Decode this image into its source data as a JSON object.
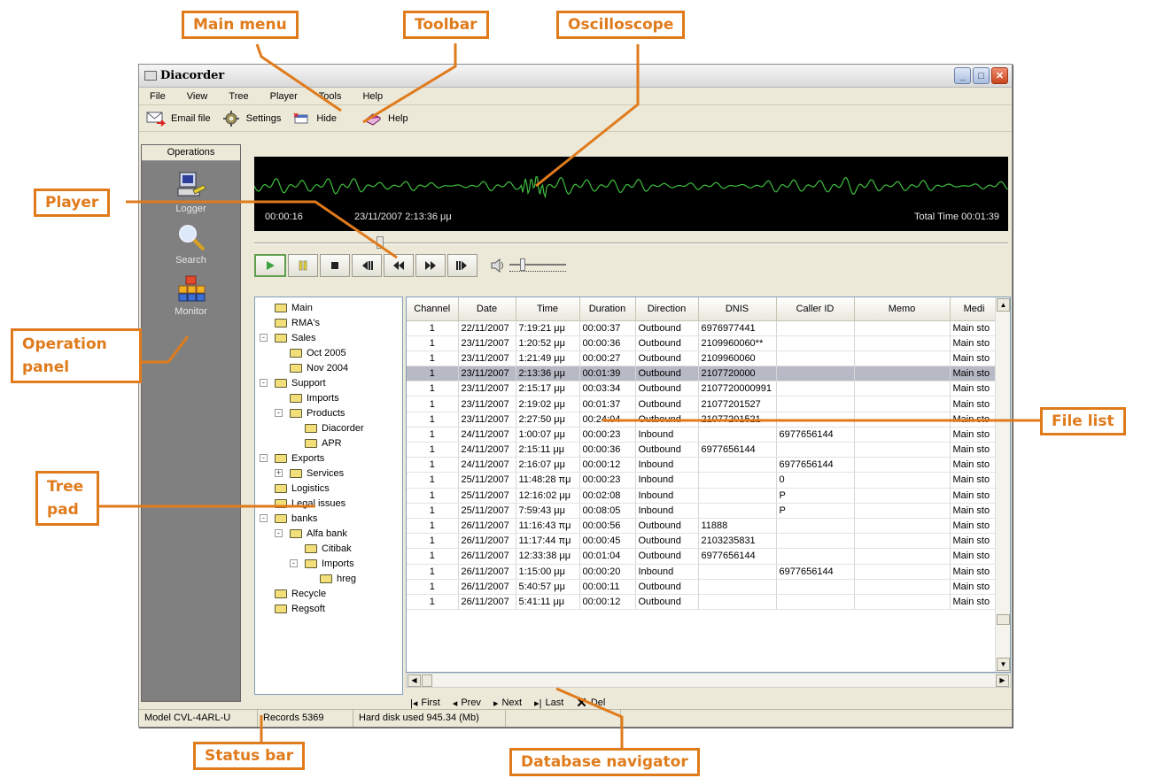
{
  "window": {
    "title": "Diacorder"
  },
  "menu": [
    "File",
    "View",
    "Tree",
    "Player",
    "Tools",
    "Help"
  ],
  "toolbar": [
    {
      "label": "Email file",
      "icon": "email-icon"
    },
    {
      "label": "Settings",
      "icon": "settings-icon"
    },
    {
      "label": "Hide",
      "icon": "hide-icon"
    },
    {
      "label": "Help",
      "icon": "help-book-icon"
    }
  ],
  "operations": {
    "header": "Operations",
    "items": [
      {
        "label": "Logger",
        "icon": "logger-icon"
      },
      {
        "label": "Search",
        "icon": "search-icon"
      },
      {
        "label": "Monitor",
        "icon": "monitor-icon"
      }
    ]
  },
  "oscilloscope": {
    "position": "00:00:16",
    "timestamp": "23/11/2007 2:13:36 μμ",
    "total": "Total Time 00:01:39",
    "seek_fraction": 0.162
  },
  "player": {
    "buttons": [
      "play-icon",
      "pause-icon",
      "stop-icon",
      "step-back-icon",
      "rewind-icon",
      "fast-forward-icon",
      "step-forward-icon"
    ],
    "volume_fraction": 0.2
  },
  "tree": [
    {
      "label": "Main",
      "depth": 0,
      "exp": "",
      "open": true
    },
    {
      "label": "RMA's",
      "depth": 0,
      "exp": ""
    },
    {
      "label": "Sales",
      "depth": 0,
      "exp": "-"
    },
    {
      "label": "Oct 2005",
      "depth": 1,
      "exp": ""
    },
    {
      "label": "Nov 2004",
      "depth": 1,
      "exp": ""
    },
    {
      "label": "Support",
      "depth": 0,
      "exp": "-"
    },
    {
      "label": "Imports",
      "depth": 1,
      "exp": ""
    },
    {
      "label": "Products",
      "depth": 1,
      "exp": "-"
    },
    {
      "label": "Diacorder",
      "depth": 2,
      "exp": ""
    },
    {
      "label": "APR",
      "depth": 2,
      "exp": ""
    },
    {
      "label": "Exports",
      "depth": 0,
      "exp": "-"
    },
    {
      "label": "Services",
      "depth": 1,
      "exp": "+"
    },
    {
      "label": "Logistics",
      "depth": 0,
      "exp": ""
    },
    {
      "label": "Legal issues",
      "depth": 0,
      "exp": ""
    },
    {
      "label": "banks",
      "depth": 0,
      "exp": "-"
    },
    {
      "label": "Alfa bank",
      "depth": 1,
      "exp": "-"
    },
    {
      "label": "Citibak",
      "depth": 2,
      "exp": ""
    },
    {
      "label": "Imports",
      "depth": 2,
      "exp": "-"
    },
    {
      "label": "hreg",
      "depth": 3,
      "exp": ""
    },
    {
      "label": "Recycle",
      "depth": 0,
      "exp": ""
    },
    {
      "label": "Regsoft",
      "depth": 0,
      "exp": ""
    }
  ],
  "filelist": {
    "columns": [
      "Channel",
      "Date",
      "Time",
      "Duration",
      "Direction",
      "DNIS",
      "Caller ID",
      "Memo",
      "Medi"
    ],
    "rows": [
      [
        "1",
        "22/11/2007",
        "7:19:21 μμ",
        "00:00:37",
        "Outbound",
        "6976977441",
        "",
        "",
        "Main sto"
      ],
      [
        "1",
        "23/11/2007",
        "1:20:52 μμ",
        "00:00:36",
        "Outbound",
        "2109960060**",
        "",
        "",
        "Main sto"
      ],
      [
        "1",
        "23/11/2007",
        "1:21:49 μμ",
        "00:00:27",
        "Outbound",
        "2109960060",
        "",
        "",
        "Main sto"
      ],
      [
        "1",
        "23/11/2007",
        "2:13:36 μμ",
        "00:01:39",
        "Outbound",
        "2107720000",
        "",
        "",
        "Main sto"
      ],
      [
        "1",
        "23/11/2007",
        "2:15:17 μμ",
        "00:03:34",
        "Outbound",
        "2107720000991",
        "",
        "",
        "Main sto"
      ],
      [
        "1",
        "23/11/2007",
        "2:19:02 μμ",
        "00:01:37",
        "Outbound",
        "21077201527",
        "",
        "",
        "Main sto"
      ],
      [
        "1",
        "23/11/2007",
        "2:27:50 μμ",
        "00:24:04",
        "Outbound",
        "21077201521",
        "",
        "",
        "Main sto"
      ],
      [
        "1",
        "24/11/2007",
        "1:00:07 μμ",
        "00:00:23",
        "Inbound",
        "",
        "6977656144",
        "",
        "Main sto"
      ],
      [
        "1",
        "24/11/2007",
        "2:15:11 μμ",
        "00:00:36",
        "Outbound",
        "6977656144",
        "",
        "",
        "Main sto"
      ],
      [
        "1",
        "24/11/2007",
        "2:16:07 μμ",
        "00:00:12",
        "Inbound",
        "",
        "6977656144",
        "",
        "Main sto"
      ],
      [
        "1",
        "25/11/2007",
        "11:48:28 πμ",
        "00:00:23",
        "Inbound",
        "",
        "0",
        "",
        "Main sto"
      ],
      [
        "1",
        "25/11/2007",
        "12:16:02 μμ",
        "00:02:08",
        "Inbound",
        "",
        "P",
        "",
        "Main sto"
      ],
      [
        "1",
        "25/11/2007",
        "7:59:43 μμ",
        "00:08:05",
        "Inbound",
        "",
        "P",
        "",
        "Main sto"
      ],
      [
        "1",
        "26/11/2007",
        "11:16:43 πμ",
        "00:00:56",
        "Outbound",
        "11888",
        "",
        "",
        "Main sto"
      ],
      [
        "1",
        "26/11/2007",
        "11:17:44 πμ",
        "00:00:45",
        "Outbound",
        "2103235831",
        "",
        "",
        "Main sto"
      ],
      [
        "1",
        "26/11/2007",
        "12:33:38 μμ",
        "00:01:04",
        "Outbound",
        "6977656144",
        "",
        "",
        "Main sto"
      ],
      [
        "1",
        "26/11/2007",
        "1:15:00 μμ",
        "00:00:20",
        "Inbound",
        "",
        "6977656144",
        "",
        "Main sto"
      ],
      [
        "1",
        "26/11/2007",
        "5:40:57 μμ",
        "00:00:11",
        "Outbound",
        "",
        "",
        "",
        "Main sto"
      ],
      [
        "1",
        "26/11/2007",
        "5:41:11 μμ",
        "00:00:12",
        "Outbound",
        "",
        "",
        "",
        "Main sto"
      ]
    ],
    "selected_index": 3
  },
  "navigator": [
    {
      "label": "First",
      "icon": "first-icon"
    },
    {
      "label": "Prev",
      "icon": "prev-icon"
    },
    {
      "label": "Next",
      "icon": "next-icon"
    },
    {
      "label": "Last",
      "icon": "last-icon"
    },
    {
      "label": "Del",
      "icon": "delete-icon"
    }
  ],
  "status": [
    "Model CVL-4ARL-U",
    "Records 5369",
    "Hard disk used  945.34 (Mb)",
    "",
    ""
  ],
  "callouts": {
    "main_menu": "Main menu",
    "toolbar": "Toolbar",
    "oscilloscope": "Oscilloscope",
    "player": "Player",
    "operation_panel": "Operation panel",
    "file_list": "File list",
    "tree_pad": "Tree pad",
    "status_bar": "Status bar",
    "database_navigator": "Database navigator"
  },
  "colors": {
    "accent": "#e07b1c",
    "wave": "#3fbf3f",
    "selected_row": "#b7b9c5",
    "ops_panel": "#808080"
  }
}
